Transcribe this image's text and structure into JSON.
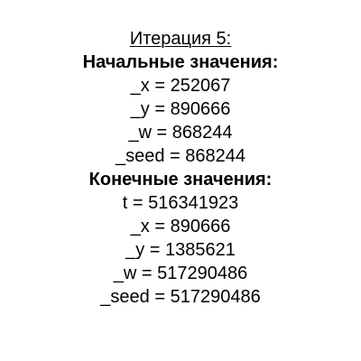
{
  "title": "Итерация 5:",
  "initial": {
    "heading": "Начальные значения:",
    "lines": [
      "_x = 252067",
      "_y = 890666",
      "_w = 868244",
      "_seed = 868244"
    ]
  },
  "final": {
    "heading": "Конечные значения:",
    "lines": [
      "t = 516341923",
      "_x = 890666",
      "_y = 1385621",
      "_w = 517290486",
      "_seed = 517290486"
    ]
  }
}
